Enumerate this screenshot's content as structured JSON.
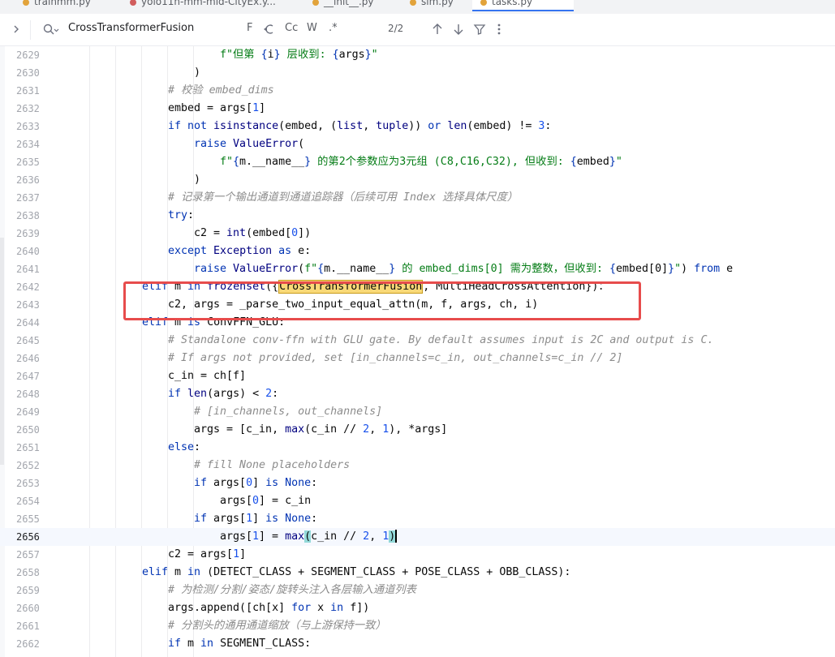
{
  "tabs": [
    {
      "label": "trainmm.py",
      "color": "#e2a33b",
      "active": false
    },
    {
      "label": "yolo11n-mm-mid-CityEx.y...",
      "color": "#d15d5d",
      "active": false
    },
    {
      "label": "__init__.py",
      "color": "#e2a33b",
      "active": false
    },
    {
      "label": "sim.py",
      "color": "#e2a33b",
      "active": false
    },
    {
      "label": "tasks.py",
      "color": "#e2a33b",
      "active": true
    }
  ],
  "search": {
    "query": "CrossTransformerFusion",
    "options": {
      "newline": "F",
      "case": "Cc",
      "words": "W",
      "regex": ".*"
    },
    "match_count": "2/2"
  },
  "lines": [
    {
      "n": "2629",
      "indent": 6,
      "tokens": [
        [
          "str",
          "f\"但第 "
        ],
        [
          "kw",
          "{"
        ],
        [
          "fn",
          "i"
        ],
        [
          "kw",
          "}"
        ],
        [
          "str",
          " 层收到: "
        ],
        [
          "kw",
          "{"
        ],
        [
          "fn",
          "args"
        ],
        [
          "kw",
          "}"
        ],
        [
          "str",
          "\""
        ]
      ]
    },
    {
      "n": "2630",
      "indent": 5,
      "tokens": [
        [
          "fn",
          ")"
        ]
      ]
    },
    {
      "n": "2631",
      "indent": 4,
      "tokens": [
        [
          "cm",
          "# 校验 embed_dims"
        ]
      ]
    },
    {
      "n": "2632",
      "indent": 4,
      "tokens": [
        [
          "fn",
          "embed = args["
        ],
        [
          "num",
          "1"
        ],
        [
          "fn",
          "]"
        ]
      ]
    },
    {
      "n": "2633",
      "indent": 4,
      "tokens": [
        [
          "kw",
          "if not "
        ],
        [
          "bi",
          "isinstance"
        ],
        [
          "fn",
          "(embed, ("
        ],
        [
          "bi",
          "list"
        ],
        [
          "fn",
          ", "
        ],
        [
          "bi",
          "tuple"
        ],
        [
          "fn",
          ")) "
        ],
        [
          "kw",
          "or "
        ],
        [
          "bi",
          "len"
        ],
        [
          "fn",
          "(embed) != "
        ],
        [
          "num",
          "3"
        ],
        [
          "fn",
          ":"
        ]
      ]
    },
    {
      "n": "2634",
      "indent": 5,
      "tokens": [
        [
          "kw",
          "raise "
        ],
        [
          "bi",
          "ValueError"
        ],
        [
          "fn",
          "("
        ]
      ]
    },
    {
      "n": "2635",
      "indent": 6,
      "tokens": [
        [
          "str",
          "f\""
        ],
        [
          "kw",
          "{"
        ],
        [
          "fn",
          "m.__name__"
        ],
        [
          "kw",
          "}"
        ],
        [
          "str",
          " 的第2个参数应为3元组 (C8,C16,C32), 但收到: "
        ],
        [
          "kw",
          "{"
        ],
        [
          "fn",
          "embed"
        ],
        [
          "kw",
          "}"
        ],
        [
          "str",
          "\""
        ]
      ]
    },
    {
      "n": "2636",
      "indent": 5,
      "tokens": [
        [
          "fn",
          ")"
        ]
      ]
    },
    {
      "n": "2637",
      "indent": 4,
      "tokens": [
        [
          "cm",
          "# 记录第一个输出通道到通道追踪器（后续可用 Index 选择具体尺度）"
        ]
      ]
    },
    {
      "n": "2638",
      "indent": 4,
      "tokens": [
        [
          "kw",
          "try"
        ],
        [
          "fn",
          ":"
        ]
      ]
    },
    {
      "n": "2639",
      "indent": 5,
      "tokens": [
        [
          "fn",
          "c2 = "
        ],
        [
          "bi",
          "int"
        ],
        [
          "fn",
          "(embed["
        ],
        [
          "num",
          "0"
        ],
        [
          "fn",
          "])"
        ]
      ]
    },
    {
      "n": "2640",
      "indent": 4,
      "tokens": [
        [
          "kw",
          "except "
        ],
        [
          "bi",
          "Exception "
        ],
        [
          "kw",
          "as "
        ],
        [
          "fn",
          "e:"
        ]
      ]
    },
    {
      "n": "2641",
      "indent": 5,
      "tokens": [
        [
          "kw",
          "raise "
        ],
        [
          "bi",
          "ValueError"
        ],
        [
          "fn",
          "("
        ],
        [
          "str",
          "f\""
        ],
        [
          "kw",
          "{"
        ],
        [
          "fn",
          "m.__name__"
        ],
        [
          "kw",
          "}"
        ],
        [
          "str",
          " 的 embed_dims[0] 需为整数，但收到: "
        ],
        [
          "kw",
          "{"
        ],
        [
          "fn",
          "embed[0]"
        ],
        [
          "kw",
          "}"
        ],
        [
          "str",
          "\""
        ],
        [
          "fn",
          ") "
        ],
        [
          "kw",
          "from "
        ],
        [
          "fn",
          "e"
        ]
      ]
    },
    {
      "n": "2642",
      "indent": 3,
      "tokens": [
        [
          "kw",
          "elif "
        ],
        [
          "fn",
          "m "
        ],
        [
          "kw",
          "in "
        ],
        [
          "bi",
          "frozenset"
        ],
        [
          "fn",
          "({"
        ],
        [
          "match",
          "CrossTransformerFusion"
        ],
        [
          "fn",
          ", MultiHeadCrossAttention})："
        ]
      ]
    },
    {
      "n": "2643",
      "indent": 4,
      "tokens": [
        [
          "fn",
          "c2, args = _parse_two_input_equal_attn(m, f, args, ch, i)"
        ]
      ]
    },
    {
      "n": "2644",
      "indent": 3,
      "tokens": [
        [
          "kw",
          "elif "
        ],
        [
          "fn",
          "m "
        ],
        [
          "kw",
          "is "
        ],
        [
          "fn",
          "ConvFFN_GLU:"
        ]
      ]
    },
    {
      "n": "2645",
      "indent": 4,
      "tokens": [
        [
          "cm",
          "# Standalone conv-ffn with GLU gate. By default assumes input is 2C and output is C."
        ]
      ]
    },
    {
      "n": "2646",
      "indent": 4,
      "tokens": [
        [
          "cm",
          "# If args not provided, set [in_channels=c_in, out_channels=c_in // 2]"
        ]
      ]
    },
    {
      "n": "2647",
      "indent": 4,
      "tokens": [
        [
          "fn",
          "c_in = ch[f]"
        ]
      ]
    },
    {
      "n": "2648",
      "indent": 4,
      "tokens": [
        [
          "kw",
          "if "
        ],
        [
          "bi",
          "len"
        ],
        [
          "fn",
          "(args) < "
        ],
        [
          "num",
          "2"
        ],
        [
          "fn",
          ":"
        ]
      ]
    },
    {
      "n": "2649",
      "indent": 5,
      "tokens": [
        [
          "cm",
          "# [in_channels, out_channels]"
        ]
      ]
    },
    {
      "n": "2650",
      "indent": 5,
      "tokens": [
        [
          "fn",
          "args = [c_in, "
        ],
        [
          "bi",
          "max"
        ],
        [
          "fn",
          "(c_in // "
        ],
        [
          "num",
          "2"
        ],
        [
          "fn",
          ", "
        ],
        [
          "num",
          "1"
        ],
        [
          "fn",
          "), *args]"
        ]
      ]
    },
    {
      "n": "2651",
      "indent": 4,
      "tokens": [
        [
          "kw",
          "else"
        ],
        [
          "fn",
          ":"
        ]
      ]
    },
    {
      "n": "2652",
      "indent": 5,
      "tokens": [
        [
          "cm",
          "# fill None placeholders"
        ]
      ]
    },
    {
      "n": "2653",
      "indent": 5,
      "tokens": [
        [
          "kw",
          "if "
        ],
        [
          "fn",
          "args["
        ],
        [
          "num",
          "0"
        ],
        [
          "fn",
          "] "
        ],
        [
          "kw",
          "is None"
        ],
        [
          "fn",
          ":"
        ]
      ]
    },
    {
      "n": "2654",
      "indent": 6,
      "tokens": [
        [
          "fn",
          "args["
        ],
        [
          "num",
          "0"
        ],
        [
          "fn",
          "] = c_in"
        ]
      ]
    },
    {
      "n": "2655",
      "indent": 5,
      "tokens": [
        [
          "kw",
          "if "
        ],
        [
          "fn",
          "args["
        ],
        [
          "num",
          "1"
        ],
        [
          "fn",
          "] "
        ],
        [
          "kw",
          "is None"
        ],
        [
          "fn",
          ":"
        ]
      ]
    },
    {
      "n": "2656",
      "indent": 6,
      "current": true,
      "tokens": [
        [
          "fn",
          "args["
        ],
        [
          "num",
          "1"
        ],
        [
          "fn",
          "] = "
        ],
        [
          "bi",
          "max"
        ],
        [
          "brace",
          "("
        ],
        [
          "fn",
          "c_in // "
        ],
        [
          "num",
          "2"
        ],
        [
          "fn",
          ", "
        ],
        [
          "num",
          "1"
        ],
        [
          "brace",
          ")"
        ],
        [
          "caret",
          ""
        ]
      ]
    },
    {
      "n": "2657",
      "indent": 4,
      "tokens": [
        [
          "fn",
          "c2 = args["
        ],
        [
          "num",
          "1"
        ],
        [
          "fn",
          "]"
        ]
      ]
    },
    {
      "n": "2658",
      "indent": 3,
      "tokens": [
        [
          "kw",
          "elif "
        ],
        [
          "fn",
          "m "
        ],
        [
          "kw",
          "in "
        ],
        [
          "fn",
          "(DETECT_CLASS + SEGMENT_CLASS + POSE_CLASS + OBB_CLASS):"
        ]
      ]
    },
    {
      "n": "2659",
      "indent": 4,
      "tokens": [
        [
          "cm",
          "# 为检测/分割/姿态/旋转头注入各层输入通道列表"
        ]
      ]
    },
    {
      "n": "2660",
      "indent": 4,
      "tokens": [
        [
          "fn",
          "args.append([ch[x] "
        ],
        [
          "kw",
          "for "
        ],
        [
          "fn",
          "x "
        ],
        [
          "kw",
          "in "
        ],
        [
          "fn",
          "f])"
        ]
      ]
    },
    {
      "n": "2661",
      "indent": 4,
      "tokens": [
        [
          "cm",
          "# 分割头的通用通道缩放（与上游保持一致）"
        ]
      ]
    },
    {
      "n": "2662",
      "indent": 4,
      "tokens": [
        [
          "kw",
          "if "
        ],
        [
          "fn",
          "m "
        ],
        [
          "kw",
          "in "
        ],
        [
          "fn",
          "SEGMENT_CLASS:"
        ]
      ]
    }
  ]
}
